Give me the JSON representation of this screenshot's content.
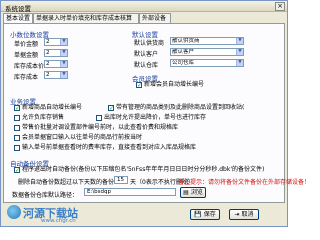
{
  "window": {
    "title": "系统设置",
    "close": "×"
  },
  "tabs": [
    {
      "label": "基本设置"
    },
    {
      "label": "单据录入时单价填充和库存成本核算"
    },
    {
      "label": "外部设备"
    }
  ],
  "decimal": {
    "title": "小数位数设置",
    "rows": [
      {
        "label": "单价金额",
        "value": "2"
      },
      {
        "label": "单据金额",
        "value": "2"
      },
      {
        "label": "库存成本价",
        "value": "2"
      },
      {
        "label": "库存成本",
        "value": "2"
      }
    ]
  },
  "defaults": {
    "title": "默认设置",
    "rows": [
      {
        "label": "默认供货商",
        "value": "散认供货商"
      },
      {
        "label": "默认客户",
        "value": "散认客户"
      },
      {
        "label": "默认仓库",
        "value": "公司仓库"
      }
    ]
  },
  "member": {
    "title": "会员设置",
    "new_member_auto": "新增会员自动增长编号"
  },
  "business": {
    "title": "业务设置",
    "new_goods_auto": "新增商品自动增长编号",
    "deleted_goods_recycle": "带有管理的商品类别及此删除商品设置到回收站(",
    "allow_negative": "允许负库存销售",
    "sale_price_memory": "出库时允许提出降价，单号也进行库存",
    "spec_multi_line": "带售价批量对调设置部件编号前时，以此查看价费和规格库",
    "add_slip_one_line": "会员单据窗口输入以往单号的商品行前按当时",
    "num_note": "输入单号前单据查看时的费率库存，直接查看到对应入库品规格库"
  },
  "backup": {
    "title": "自动备份设置",
    "auto_backup_prefix": "程序退出时自动备份(备份以下压缩包名'5nFss年年年月日日日时分分秒秒.dbk'的备份文件)",
    "delete_days_label": "删除自动备份数超过以下天数的备份：",
    "delete_days_value": "15",
    "delete_days_hint": "天（0表示不执行删除）",
    "delete_days_warn": "备注提示：请勿将备份文件备份在外部存储设备！",
    "path_label": "数据备份仓库默认路径：",
    "path_value": "E:\\bsdqp",
    "browse": "浏览"
  },
  "watermark": {
    "brand": "河源下载站",
    "url": "www.cngr.cn"
  },
  "footer": {
    "save": "保存",
    "cancel": "取消"
  }
}
